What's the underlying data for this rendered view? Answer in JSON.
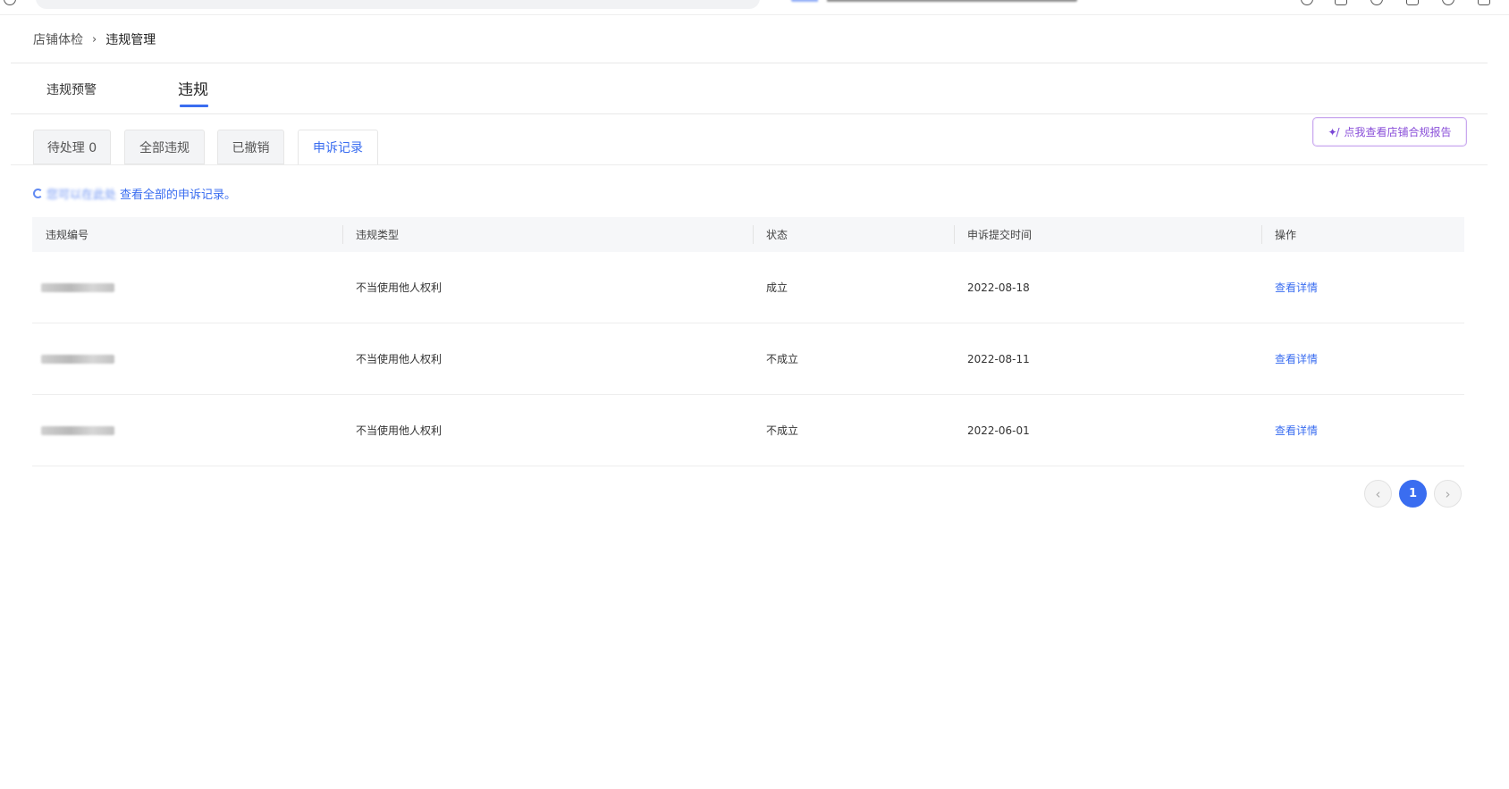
{
  "breadcrumb": {
    "parent": "店铺体检",
    "separator": "›",
    "current": "违规管理"
  },
  "main_tabs": [
    {
      "label": "违规预警",
      "active": false
    },
    {
      "label": "违规",
      "active": true
    }
  ],
  "sub_tabs": [
    {
      "label": "待处理 0",
      "active": false
    },
    {
      "label": "全部违规",
      "active": false
    },
    {
      "label": "已撤销",
      "active": false
    },
    {
      "label": "申诉记录",
      "active": true
    }
  ],
  "report_button": {
    "icon": "sparkle-icon",
    "label": "点我查看店铺合规报告"
  },
  "notice": {
    "prefix": "您可以在此处",
    "text": "查看全部的申诉记录。"
  },
  "table": {
    "columns": [
      "违规编号",
      "违规类型",
      "状态",
      "申诉提交时间",
      "操作"
    ],
    "rows": [
      {
        "type": "不当使用他人权利",
        "status": "成立",
        "time": "2022-08-18",
        "action": "查看详情"
      },
      {
        "type": "不当使用他人权利",
        "status": "不成立",
        "time": "2022-08-11",
        "action": "查看详情"
      },
      {
        "type": "不当使用他人权利",
        "status": "不成立",
        "time": "2022-06-01",
        "action": "查看详情"
      }
    ]
  },
  "pagination": {
    "prev": "‹",
    "current": "1",
    "next": "›"
  },
  "colors": {
    "accent": "#3a6df0",
    "report_border": "#c9a8ee",
    "report_text": "#8a4fd9"
  }
}
